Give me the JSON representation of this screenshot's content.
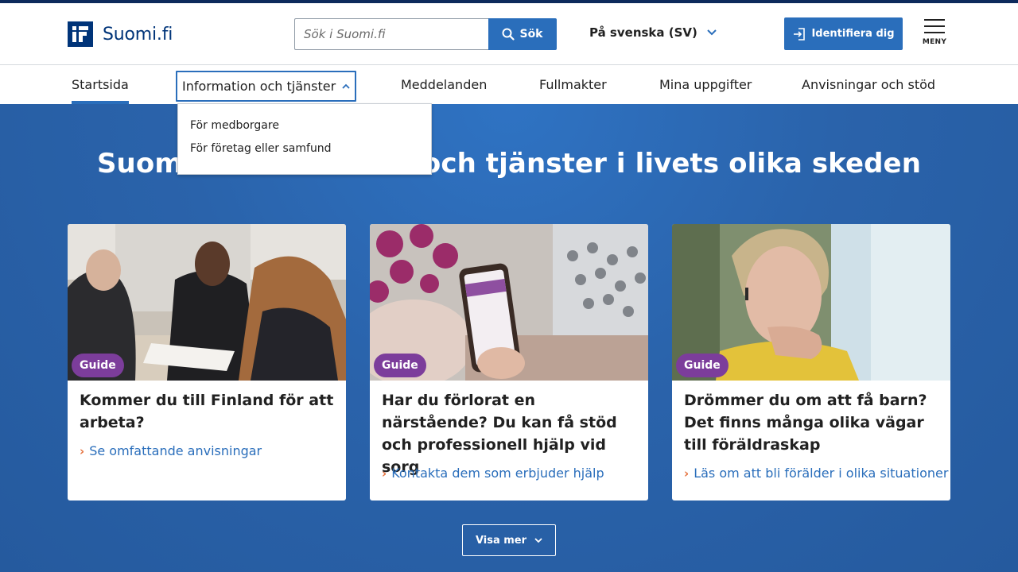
{
  "header": {
    "logo_text": "Suomi.fi",
    "search_placeholder": "Sök i Suomi.fi",
    "search_button": "Sök",
    "language": "På svenska (SV)",
    "identify_button": "Identifiera dig",
    "menu_label": "MENY"
  },
  "nav": {
    "items": [
      {
        "label": "Startsida"
      },
      {
        "label": "Information och tjänster"
      },
      {
        "label": "Meddelanden"
      },
      {
        "label": "Fullmakter"
      },
      {
        "label": "Mina uppgifter"
      },
      {
        "label": "Anvisningar och stöd"
      }
    ],
    "active": "Startsida",
    "open": "Information och tjänster",
    "dropdown": [
      {
        "label": "För medborgare"
      },
      {
        "label": "För företag eller samfund"
      }
    ]
  },
  "hero": {
    "title": "Suomi.fi information och tjänster i livets olika skeden"
  },
  "cards": [
    {
      "badge": "Guide",
      "title": "Kommer du till Finland för att arbeta?",
      "link": "Se omfattande anvisningar"
    },
    {
      "badge": "Guide",
      "title": "Har du förlorat en närstående? Du kan få stöd och professionell hjälp vid sorg",
      "link": "Kontakta dem som erbjuder hjälp"
    },
    {
      "badge": "Guide",
      "title": "Drömmer du om att få barn? Det finns många olika vägar till föräldraskap",
      "link": "Läs om att bli förälder i olika situationer"
    }
  ],
  "more_button": "Visa mer",
  "colors": {
    "brand": "#003479",
    "accent": "#2a6ebb",
    "badge": "#7c3d9b",
    "link_chevron": "#e5713c"
  }
}
